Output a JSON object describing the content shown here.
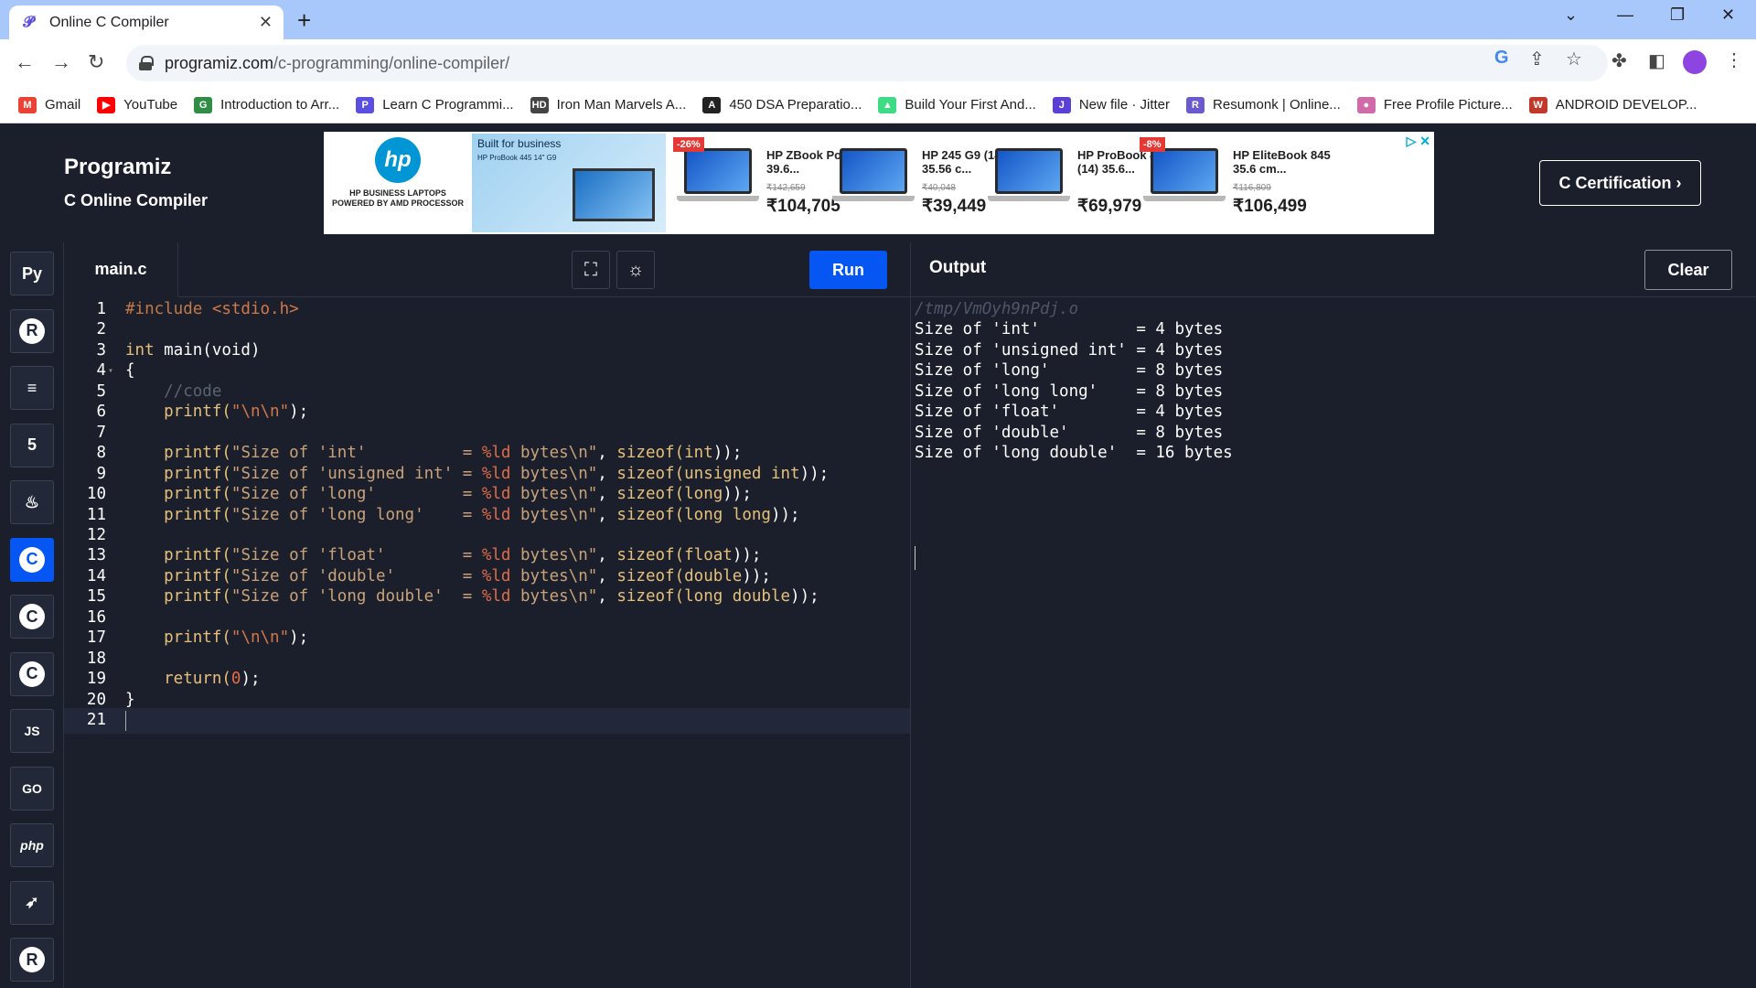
{
  "browser": {
    "tab_title": "Online C Compiler",
    "url_host": "programiz.com",
    "url_path": "/c-programming/online-compiler/",
    "bookmarks": [
      {
        "label": "Gmail",
        "icon": "gmail-icon",
        "color": "#ea4335",
        "glyph": "M"
      },
      {
        "label": "YouTube",
        "icon": "youtube-icon",
        "color": "#ff0000",
        "glyph": "▶"
      },
      {
        "label": "Introduction to Arr...",
        "icon": "gfg-icon",
        "color": "#2f8d46",
        "glyph": "G"
      },
      {
        "label": "Learn C Programmi...",
        "icon": "programiz-icon",
        "color": "#5b4fe0",
        "glyph": "P"
      },
      {
        "label": "Iron Man Marvels A...",
        "icon": "hd-icon",
        "color": "#444444",
        "glyph": "HD"
      },
      {
        "label": "450 DSA Preparatio...",
        "icon": "angular-icon",
        "color": "#222222",
        "glyph": "A"
      },
      {
        "label": "Build Your First And...",
        "icon": "android-icon",
        "color": "#3ddc84",
        "glyph": "▲"
      },
      {
        "label": "New file · Jitter",
        "icon": "jitter-icon",
        "color": "#5b3fd6",
        "glyph": "J"
      },
      {
        "label": "Resumonk | Online...",
        "icon": "resumonk-icon",
        "color": "#6a5acd",
        "glyph": "R"
      },
      {
        "label": "Free Profile Picture...",
        "icon": "profile-pic-icon",
        "color": "#d06aa8",
        "glyph": "●"
      },
      {
        "label": "ANDROID DEVELOP...",
        "icon": "w3-icon",
        "color": "#c0392b",
        "glyph": "W"
      }
    ]
  },
  "header": {
    "logo": "Programiz",
    "subtitle": "C Online Compiler",
    "cert_button": "C Certification ›"
  },
  "ad": {
    "hp_tagline": "HP BUSINESS LAPTOPS POWERED BY AMD PROCESSOR",
    "banner_title": "Built for business",
    "banner_sub": "HP ProBook 445 14\" G9",
    "products": [
      {
        "name": "HP ZBook Power 39.6...",
        "old_price": "₹142,659",
        "price": "₹104,705",
        "discount": "-26%"
      },
      {
        "name": "HP 245 G9 (14) 35.56 c...",
        "old_price": "₹40,048",
        "price": "₹39,449",
        "discount": ""
      },
      {
        "name": "HP ProBook 445 (14) 35.6...",
        "old_price": "",
        "price": "₹69,979",
        "discount": ""
      },
      {
        "name": "HP EliteBook 845 35.6 cm...",
        "old_price": "₹116,809",
        "price": "₹106,499",
        "discount": "-8%"
      }
    ]
  },
  "sidebar": {
    "languages": [
      {
        "name": "python",
        "glyph": "Py",
        "active": false
      },
      {
        "name": "r",
        "glyph": "R",
        "active": false
      },
      {
        "name": "sql",
        "glyph": "≡",
        "active": false
      },
      {
        "name": "html",
        "glyph": "5",
        "active": false
      },
      {
        "name": "java",
        "glyph": "♨",
        "active": false
      },
      {
        "name": "c",
        "glyph": "C",
        "active": true
      },
      {
        "name": "cpp",
        "glyph": "C",
        "active": false
      },
      {
        "name": "csharp",
        "glyph": "C",
        "active": false
      },
      {
        "name": "javascript",
        "glyph": "JS",
        "active": false
      },
      {
        "name": "go",
        "glyph": "GO",
        "active": false
      },
      {
        "name": "php",
        "glyph": "php",
        "active": false
      },
      {
        "name": "swift",
        "glyph": "➶",
        "active": false
      },
      {
        "name": "rust",
        "glyph": "R",
        "active": false
      }
    ]
  },
  "editor": {
    "file_name": "main.c",
    "run_label": "Run",
    "lines": [
      {
        "n": "1",
        "parts": [
          [
            "#include ",
            "#c07a4a"
          ],
          [
            "<stdio.h>",
            "#d2784a"
          ]
        ]
      },
      {
        "n": "2",
        "parts": []
      },
      {
        "n": "3",
        "parts": [
          [
            "int",
            "#e6c07b"
          ],
          [
            " main(void)",
            "#ffffff"
          ]
        ]
      },
      {
        "n": "4",
        "parts": [
          [
            "{",
            "#ffffff"
          ]
        ],
        "fold": true
      },
      {
        "n": "5",
        "parts": [
          [
            "    //code",
            "#5c6370"
          ]
        ]
      },
      {
        "n": "6",
        "parts": [
          [
            "    printf(",
            "#e6c07b"
          ],
          [
            "\"\\n\\n\"",
            "#d2784a"
          ],
          [
            ");",
            "#ffffff"
          ]
        ]
      },
      {
        "n": "7",
        "parts": []
      },
      {
        "n": "8",
        "parts": [
          [
            "    printf(",
            "#e6c07b"
          ],
          [
            "\"Size of 'int'          = ",
            "#c9a27a"
          ],
          [
            "%ld",
            "#e06c4a"
          ],
          [
            " bytes\\n\"",
            "#c9a27a"
          ],
          [
            ", ",
            "#ffffff"
          ],
          [
            "sizeof(",
            "#e6c07b"
          ],
          [
            "int",
            "#e6c07b"
          ],
          [
            "));",
            "#ffffff"
          ]
        ]
      },
      {
        "n": "9",
        "parts": [
          [
            "    printf(",
            "#e6c07b"
          ],
          [
            "\"Size of 'unsigned int' = ",
            "#c9a27a"
          ],
          [
            "%ld",
            "#e06c4a"
          ],
          [
            " bytes\\n\"",
            "#c9a27a"
          ],
          [
            ", ",
            "#ffffff"
          ],
          [
            "sizeof(",
            "#e6c07b"
          ],
          [
            "unsigned int",
            "#e6c07b"
          ],
          [
            "));",
            "#ffffff"
          ]
        ]
      },
      {
        "n": "10",
        "parts": [
          [
            "    printf(",
            "#e6c07b"
          ],
          [
            "\"Size of 'long'         = ",
            "#c9a27a"
          ],
          [
            "%ld",
            "#e06c4a"
          ],
          [
            " bytes\\n\"",
            "#c9a27a"
          ],
          [
            ", ",
            "#ffffff"
          ],
          [
            "sizeof(",
            "#e6c07b"
          ],
          [
            "long",
            "#e6c07b"
          ],
          [
            "));",
            "#ffffff"
          ]
        ]
      },
      {
        "n": "11",
        "parts": [
          [
            "    printf(",
            "#e6c07b"
          ],
          [
            "\"Size of 'long long'    = ",
            "#c9a27a"
          ],
          [
            "%ld",
            "#e06c4a"
          ],
          [
            " bytes\\n\"",
            "#c9a27a"
          ],
          [
            ", ",
            "#ffffff"
          ],
          [
            "sizeof(",
            "#e6c07b"
          ],
          [
            "long long",
            "#e6c07b"
          ],
          [
            "));",
            "#ffffff"
          ]
        ]
      },
      {
        "n": "12",
        "parts": []
      },
      {
        "n": "13",
        "parts": [
          [
            "    printf(",
            "#e6c07b"
          ],
          [
            "\"Size of 'float'        = ",
            "#c9a27a"
          ],
          [
            "%ld",
            "#e06c4a"
          ],
          [
            " bytes\\n\"",
            "#c9a27a"
          ],
          [
            ", ",
            "#ffffff"
          ],
          [
            "sizeof(",
            "#e6c07b"
          ],
          [
            "float",
            "#e6c07b"
          ],
          [
            "));",
            "#ffffff"
          ]
        ]
      },
      {
        "n": "14",
        "parts": [
          [
            "    printf(",
            "#e6c07b"
          ],
          [
            "\"Size of 'double'       = ",
            "#c9a27a"
          ],
          [
            "%ld",
            "#e06c4a"
          ],
          [
            " bytes\\n\"",
            "#c9a27a"
          ],
          [
            ", ",
            "#ffffff"
          ],
          [
            "sizeof(",
            "#e6c07b"
          ],
          [
            "double",
            "#e6c07b"
          ],
          [
            "));",
            "#ffffff"
          ]
        ]
      },
      {
        "n": "15",
        "parts": [
          [
            "    printf(",
            "#e6c07b"
          ],
          [
            "\"Size of 'long double'  = ",
            "#c9a27a"
          ],
          [
            "%ld",
            "#e06c4a"
          ],
          [
            " bytes\\n\"",
            "#c9a27a"
          ],
          [
            ", ",
            "#ffffff"
          ],
          [
            "sizeof(",
            "#e6c07b"
          ],
          [
            "long double",
            "#e6c07b"
          ],
          [
            "));",
            "#ffffff"
          ]
        ]
      },
      {
        "n": "16",
        "parts": []
      },
      {
        "n": "17",
        "parts": [
          [
            "    printf(",
            "#e6c07b"
          ],
          [
            "\"\\n\\n\"",
            "#d2784a"
          ],
          [
            ");",
            "#ffffff"
          ]
        ]
      },
      {
        "n": "18",
        "parts": []
      },
      {
        "n": "19",
        "parts": [
          [
            "    return(",
            "#e6c07b"
          ],
          [
            "0",
            "#e06c4a"
          ],
          [
            ");",
            "#ffffff"
          ]
        ]
      },
      {
        "n": "20",
        "parts": [
          [
            "}",
            "#ffffff"
          ]
        ]
      },
      {
        "n": "21",
        "parts": [],
        "current": true
      }
    ]
  },
  "output": {
    "title": "Output",
    "clear_label": "Clear",
    "path": "/tmp/VmOyh9nPdj.o",
    "lines": [
      "Size of 'int'          = 4 bytes",
      "Size of 'unsigned int' = 4 bytes",
      "Size of 'long'         = 8 bytes",
      "Size of 'long long'    = 8 bytes",
      "Size of 'float'        = 4 bytes",
      "Size of 'double'       = 8 bytes",
      "Size of 'long double'  = 16 bytes"
    ]
  }
}
